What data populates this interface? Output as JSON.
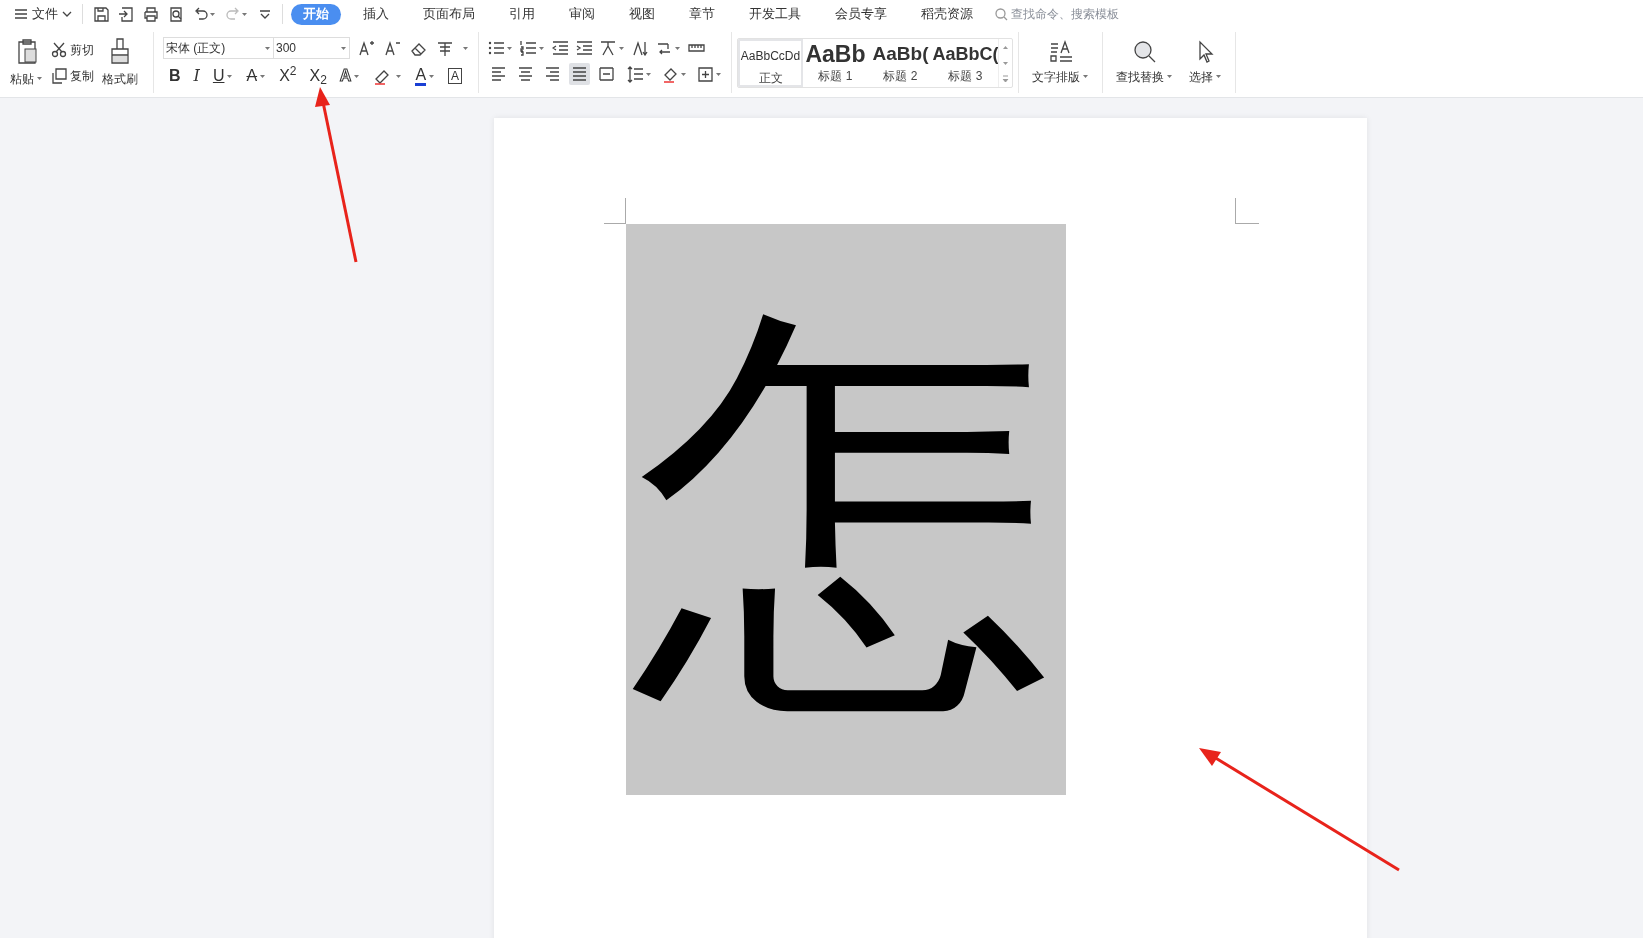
{
  "menu_bar": {
    "file_menu": "文件",
    "tabs": [
      {
        "label": "开始",
        "selected": true
      },
      {
        "label": "插入",
        "selected": false
      },
      {
        "label": "页面布局",
        "selected": false
      },
      {
        "label": "引用",
        "selected": false
      },
      {
        "label": "审阅",
        "selected": false
      },
      {
        "label": "视图",
        "selected": false
      },
      {
        "label": "章节",
        "selected": false
      },
      {
        "label": "开发工具",
        "selected": false
      },
      {
        "label": "会员专享",
        "selected": false
      },
      {
        "label": "稻壳资源",
        "selected": false
      }
    ],
    "search": {
      "placeholder": "查找命令、搜索模板"
    }
  },
  "ribbon": {
    "clipboard": {
      "paste": "粘贴",
      "cut": "剪切",
      "copy": "复制",
      "format_painter": "格式刷"
    },
    "font": {
      "name": "宋体 (正文)",
      "size": "300",
      "format_buttons": [
        {
          "kind": "bold",
          "label": "B"
        },
        {
          "kind": "italic",
          "label": "I"
        },
        {
          "kind": "underline",
          "label": "U"
        },
        {
          "kind": "strike",
          "label": "A"
        },
        {
          "kind": "superscript",
          "label": "X$^{2}$"
        },
        {
          "kind": "subscript",
          "label": "X$_{2}$"
        },
        {
          "kind": "effect",
          "label": "A"
        },
        {
          "kind": "highlight"
        },
        {
          "kind": "color",
          "label": "A"
        },
        {
          "kind": "border",
          "label": "A"
        }
      ]
    },
    "paragraph": {
      "alignment": [
        {
          "selected": false
        },
        {
          "selected": false
        },
        {
          "selected": false
        },
        {
          "selected": true
        },
        {
          "selected": false
        }
      ]
    },
    "styles": [
      {
        "preview": "AaBbCcDd",
        "label": "正文",
        "kind": "normal",
        "selected": true
      },
      {
        "preview": "AaBb",
        "label": "标题 1",
        "kind": "h1",
        "selected": false
      },
      {
        "preview": "AaBb(",
        "label": "标题 2",
        "kind": "h2",
        "selected": false
      },
      {
        "preview": "AaBbC(",
        "label": "标题 3",
        "kind": "h3",
        "selected": false
      }
    ],
    "text_layout": "文字排版",
    "find_replace": "查找替换",
    "select": "选择"
  },
  "document": {
    "character": "怎"
  }
}
